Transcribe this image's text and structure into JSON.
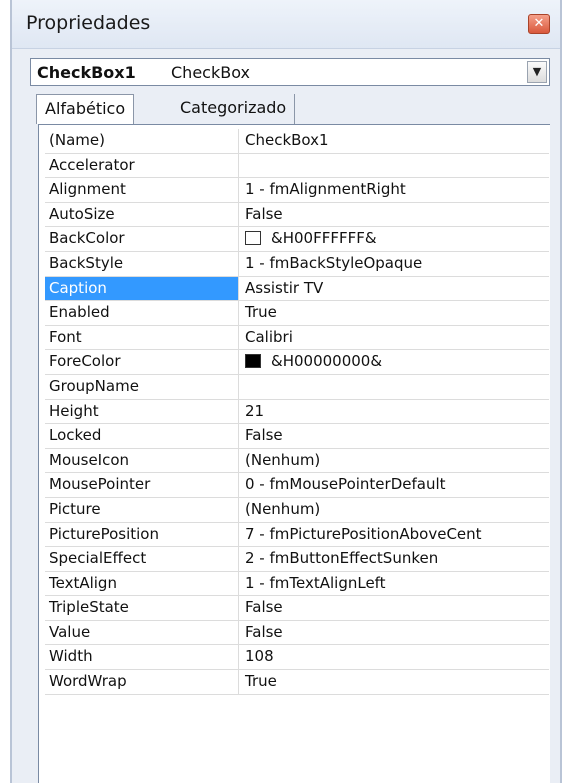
{
  "window": {
    "title": "Propriedades"
  },
  "object_selector": {
    "name": "CheckBox1",
    "type": "CheckBox"
  },
  "tabs": [
    {
      "label": "Alfabético",
      "active": true
    },
    {
      "label": "Categorizado",
      "active": false
    }
  ],
  "properties": [
    {
      "name": "(Name)",
      "value": "CheckBox1"
    },
    {
      "name": "Accelerator",
      "value": ""
    },
    {
      "name": "Alignment",
      "value": "1 - fmAlignmentRight"
    },
    {
      "name": "AutoSize",
      "value": "False"
    },
    {
      "name": "BackColor",
      "value": "&H00FFFFFF&",
      "swatch": "#ffffff"
    },
    {
      "name": "BackStyle",
      "value": "1 - fmBackStyleOpaque"
    },
    {
      "name": "Caption",
      "value": "Assistir TV",
      "selected": true
    },
    {
      "name": "Enabled",
      "value": "True"
    },
    {
      "name": "Font",
      "value": "Calibri"
    },
    {
      "name": "ForeColor",
      "value": "&H00000000&",
      "swatch": "#000000"
    },
    {
      "name": "GroupName",
      "value": ""
    },
    {
      "name": "Height",
      "value": "21"
    },
    {
      "name": "Locked",
      "value": "False"
    },
    {
      "name": "MouseIcon",
      "value": "(Nenhum)"
    },
    {
      "name": "MousePointer",
      "value": "0 - fmMousePointerDefault"
    },
    {
      "name": "Picture",
      "value": "(Nenhum)"
    },
    {
      "name": "PicturePosition",
      "value": "7 - fmPicturePositionAboveCent"
    },
    {
      "name": "SpecialEffect",
      "value": "2 - fmButtonEffectSunken"
    },
    {
      "name": "TextAlign",
      "value": "1 - fmTextAlignLeft"
    },
    {
      "name": "TripleState",
      "value": "False"
    },
    {
      "name": "Value",
      "value": "False"
    },
    {
      "name": "Width",
      "value": "108"
    },
    {
      "name": "WordWrap",
      "value": "True"
    }
  ],
  "colors": {
    "selection": "#3399ff",
    "panel_bg": "#eaeef5"
  },
  "icons": {
    "close": "close-icon",
    "dropdown": "chevron-down-icon"
  }
}
